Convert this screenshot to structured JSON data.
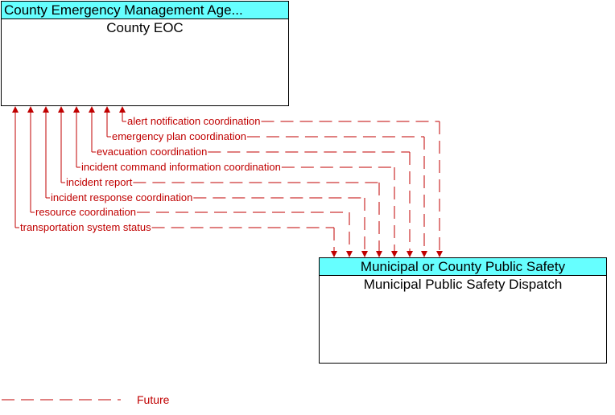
{
  "colors": {
    "flow": "#c00000",
    "header_bg": "#66ffff",
    "border": "#000000"
  },
  "top_element": {
    "header": "County Emergency Management Age...",
    "title": "County EOC"
  },
  "bottom_element": {
    "header": "Municipal or County Public Safety",
    "title": "Municipal Public Safety Dispatch"
  },
  "flows": [
    {
      "label": "alert notification coordination",
      "status": "Future",
      "direction": "to-top"
    },
    {
      "label": "emergency plan coordination",
      "status": "Future",
      "direction": "to-top"
    },
    {
      "label": "evacuation coordination",
      "status": "Future",
      "direction": "to-top"
    },
    {
      "label": "incident command information coordination",
      "status": "Future",
      "direction": "to-top"
    },
    {
      "label": "incident report",
      "status": "Future",
      "direction": "to-top"
    },
    {
      "label": "incident response coordination",
      "status": "Future",
      "direction": "to-top"
    },
    {
      "label": "resource coordination",
      "status": "Future",
      "direction": "to-top"
    },
    {
      "label": "transportation system status",
      "status": "Future",
      "direction": "to-top"
    }
  ],
  "legend": {
    "future_label": "Future"
  }
}
